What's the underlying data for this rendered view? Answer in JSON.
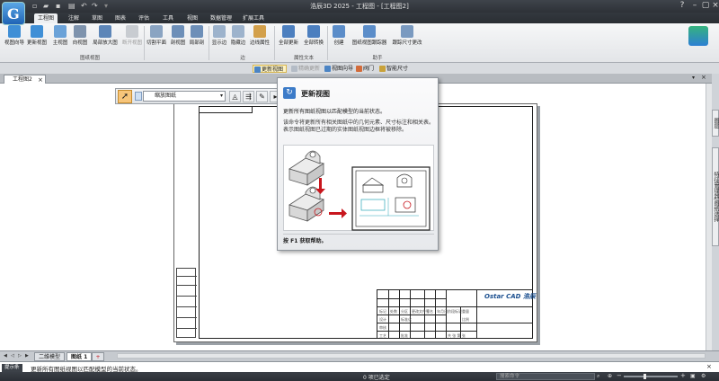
{
  "window": {
    "title": "浩辰3D 2025 - 工程图 - [工程图2]",
    "controls": [
      "help-icon",
      "minimize-icon",
      "restore-icon",
      "close-icon"
    ]
  },
  "ribbon": {
    "tabs": [
      "工程图",
      "注解",
      "草图",
      "图表",
      "评估",
      "工具",
      "视图",
      "数据管理",
      "扩展工具"
    ],
    "active_tab": "工程图",
    "groups": [
      {
        "label": "图纸视图",
        "buttons": [
          "视图向导",
          "更新视图",
          "主视图",
          "向视图",
          "局部放大图",
          "断开视图"
        ]
      },
      {
        "label": "",
        "buttons": [
          "切割平面",
          "剖视图",
          "局部剖"
        ]
      },
      {
        "label": "边",
        "buttons": [
          "显示边",
          "隐藏边",
          "边线属性"
        ]
      },
      {
        "label": "属性文本",
        "buttons": [
          "全部更新",
          "全部转换"
        ]
      },
      {
        "label": "助手",
        "buttons": [
          "创建",
          "图纸视图跟踪器",
          "跟踪尺寸更改"
        ]
      }
    ]
  },
  "subtoolbar": {
    "items": [
      "更新视图",
      "精确更新",
      "视图向导",
      "阀门",
      "智能尺寸"
    ],
    "pressed": "更新视图"
  },
  "document_tab": {
    "label": "工程图2",
    "close": "×"
  },
  "floating_toolbar": {
    "select_value": "缩放图纸"
  },
  "tooltip": {
    "title": "更新视图",
    "summary": "更新所有图纸视图以匹配模型的当前状态。",
    "description": "该命令将更新所有相关图纸中的几何元素、尺寸标注和相关表。表示图纸视图已过期的实体图纸视图边框将被移除。",
    "help": "按 F1 获取帮助。"
  },
  "title_block": {
    "logo": "Ostar CAD 浩辰",
    "small_texts": [
      "标记",
      "处数",
      "分区",
      "更改文件号",
      "签名",
      "年月日",
      "设计",
      "标准化",
      "审核",
      "工艺",
      "批准",
      "阶段标记",
      "重量",
      "比例",
      "共 张 第 张"
    ]
  },
  "sheet_tabs": {
    "tabs": [
      "二维模型",
      "图纸 1"
    ],
    "active": "图纸 1"
  },
  "command_line": {
    "label": "提示条",
    "text": "更新所有图纸视图以匹配模型的当前状态。"
  },
  "status_bar": {
    "selection": "0 项已选定",
    "search_placeholder": "搜索命令",
    "zoom_level": 0.38
  },
  "right_dock": {
    "tabs": [
      "图层",
      "特征管理器/图纸选择"
    ]
  },
  "colors": {
    "titlebar": "#2d3137",
    "ribbon": "#eceef1",
    "pressed": "#fdf3c4",
    "arrow_red": "#c8161d",
    "logo_blue": "#1b4f8f"
  }
}
